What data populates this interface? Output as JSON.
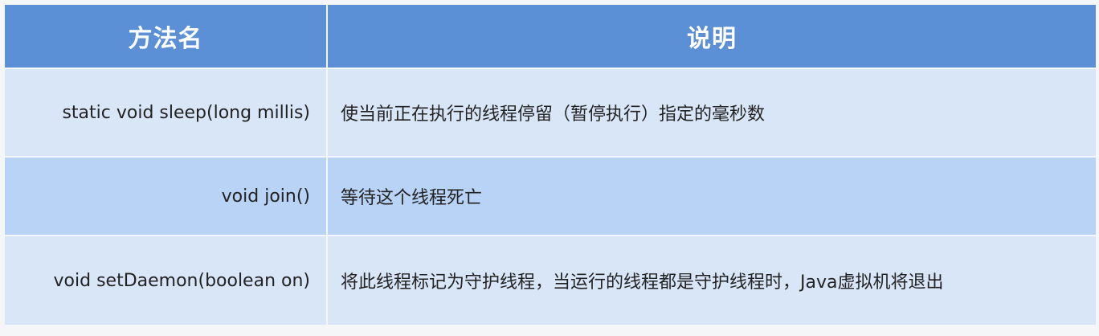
{
  "table": {
    "headers": {
      "method_name": "方法名",
      "description": "说明"
    },
    "rows": [
      {
        "method": "static void sleep(long millis)",
        "description": "使当前正在执行的线程停留（暂停执行）指定的毫秒数"
      },
      {
        "method": "void join()",
        "description": "等待这个线程死亡"
      },
      {
        "method": "void setDaemon(boolean on)",
        "description": "将此线程标记为守护线程，当运行的线程都是守护线程时，Java虚拟机将退出"
      }
    ]
  }
}
